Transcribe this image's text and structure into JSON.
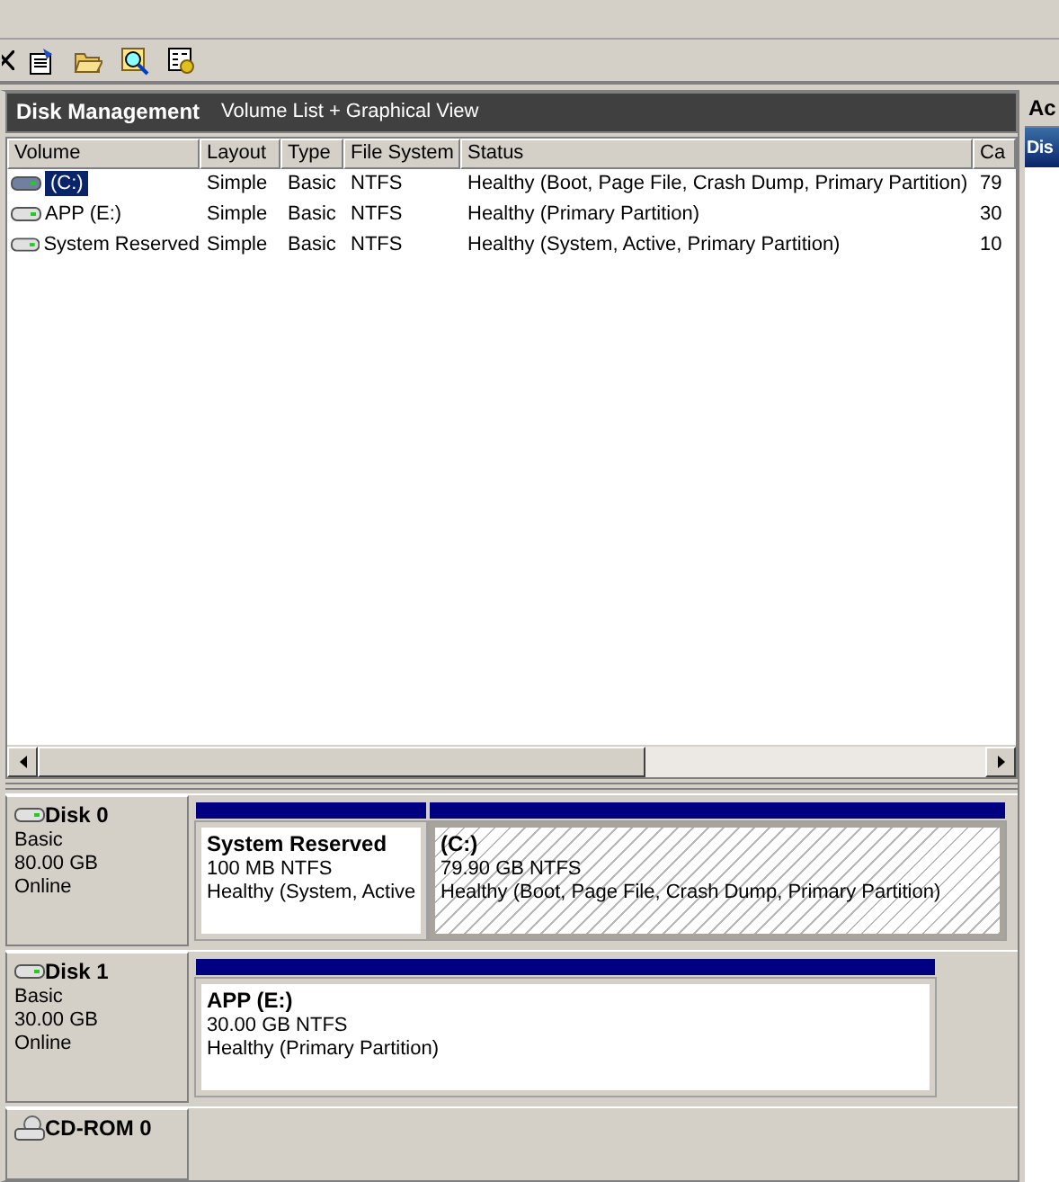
{
  "panel": {
    "title": "Disk Management",
    "subtitle": "Volume List + Graphical View"
  },
  "volume_list": {
    "columns": [
      "Volume",
      "Layout",
      "Type",
      "File System",
      "Status",
      "Ca"
    ],
    "rows": [
      {
        "selected": true,
        "cells": [
          "(C:)",
          "Simple",
          "Basic",
          "NTFS",
          "Healthy (Boot, Page File, Crash Dump, Primary Partition)",
          "79"
        ]
      },
      {
        "selected": false,
        "cells": [
          "APP (E:)",
          "Simple",
          "Basic",
          "NTFS",
          "Healthy (Primary Partition)",
          "30"
        ]
      },
      {
        "selected": false,
        "cells": [
          "System Reserved",
          "Simple",
          "Basic",
          "NTFS",
          "Healthy (System, Active, Primary Partition)",
          "10"
        ]
      }
    ]
  },
  "disks": [
    {
      "kind": "disk",
      "name": "Disk 0",
      "type": "Basic",
      "size": "80.00 GB",
      "status": "Online",
      "partitions": [
        {
          "label": "System Reserved",
          "size": "100 MB NTFS",
          "status": "Healthy (System, Active",
          "selected": false
        },
        {
          "label": "(C:)",
          "size": "79.90 GB NTFS",
          "status": "Healthy (Boot, Page File, Crash Dump, Primary Partition)",
          "selected": true
        }
      ]
    },
    {
      "kind": "disk",
      "name": "Disk 1",
      "type": "Basic",
      "size": "30.00 GB",
      "status": "Online",
      "partitions": [
        {
          "label": "APP  (E:)",
          "size": "30.00 GB NTFS",
          "status": "Healthy (Primary Partition)",
          "selected": false
        }
      ]
    },
    {
      "kind": "cdrom",
      "name": "CD-ROM 0"
    }
  ],
  "actions": {
    "header": "Ac",
    "items": [
      {
        "label": "Dis",
        "selected": true
      }
    ]
  }
}
